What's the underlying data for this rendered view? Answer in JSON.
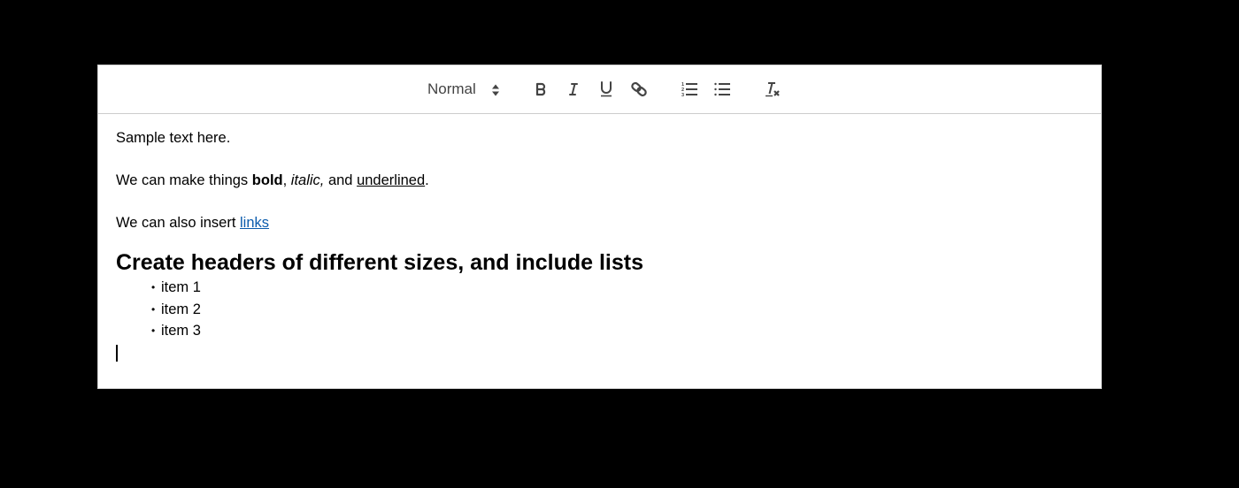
{
  "toolbar": {
    "header_select": {
      "selected": "Normal",
      "icon": "updown-arrows-icon"
    },
    "buttons": [
      {
        "name": "bold",
        "icon": "bold-icon"
      },
      {
        "name": "italic",
        "icon": "italic-icon"
      },
      {
        "name": "underline",
        "icon": "underline-icon"
      },
      {
        "name": "link",
        "icon": "link-icon"
      },
      {
        "name": "ordered-list",
        "icon": "ordered-list-icon"
      },
      {
        "name": "bullet-list",
        "icon": "bullet-list-icon"
      },
      {
        "name": "clear-formatting",
        "icon": "clear-formatting-icon"
      }
    ]
  },
  "content": {
    "line1": "Sample text here.",
    "line2": {
      "prefix": "We can make things ",
      "bold": "bold",
      "sep1": ", ",
      "italic": "italic,",
      "sep2": " and ",
      "underlined": "underlined",
      "suffix": "."
    },
    "line3": {
      "prefix": "We can also insert ",
      "link": "links"
    },
    "heading": "Create headers of different sizes, and include lists",
    "list_bullet": "•",
    "list_items": [
      "item 1",
      "item 2",
      "item 3"
    ]
  }
}
